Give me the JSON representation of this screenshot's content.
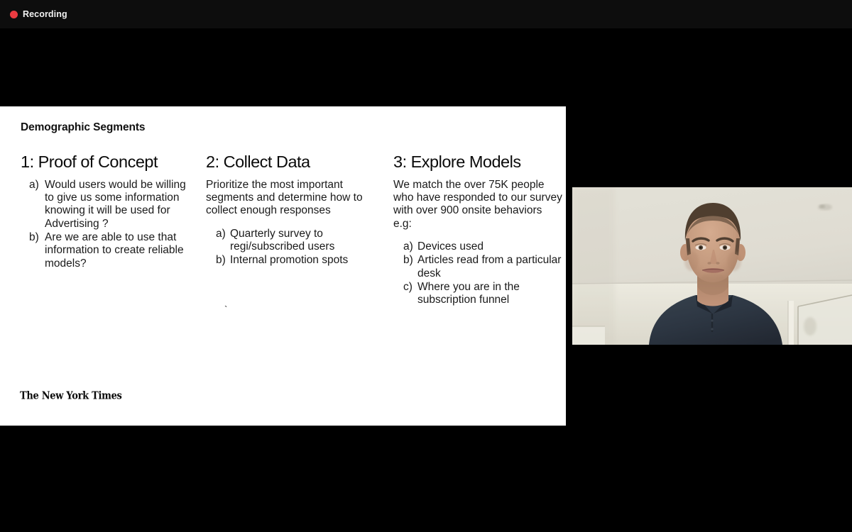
{
  "recording": {
    "label": "Recording",
    "dot_color": "#ea3b41",
    "text_color": "#f2f2f2"
  },
  "slide": {
    "title": "Demographic Segments",
    "background": "#ffffff",
    "footer_logo": "The New York Times",
    "stray_mark": "`",
    "columns": [
      {
        "heading": "1: Proof of Concept",
        "intro": "",
        "items": [
          {
            "marker": "a)",
            "text": "Would users would be willing to give us some information knowing it will be used for Advertising ?"
          },
          {
            "marker": "b)",
            "text": "Are we are able to use that information to create reliable models?"
          }
        ]
      },
      {
        "heading": "2: Collect Data",
        "intro": "Prioritize the most important segments and determine how to collect enough responses",
        "items": [
          {
            "marker": "a)",
            "text": "Quarterly survey to regi/subscribed users"
          },
          {
            "marker": "b)",
            "text": "Internal promotion spots"
          }
        ]
      },
      {
        "heading": "3: Explore Models",
        "intro": "We match the over 75K people who have responded to our survey with over 900 onsite behaviors e.g:",
        "items": [
          {
            "marker": "a)",
            "text": "Devices used"
          },
          {
            "marker": "b)",
            "text": "Articles read from a particular desk"
          },
          {
            "marker": "c)",
            "text": "Where you are in the subscription funnel"
          }
        ]
      }
    ]
  },
  "video": {
    "label": "participant-webcam",
    "description": "Man in dark navy polo shirt seated in front of a light beige wall with a white door frame on the right",
    "wall_color": "#ddd9cf",
    "shirt_color": "#2a3340",
    "skin_color": "#c79a7e",
    "hair_color": "#4c3a2c"
  },
  "stage": {
    "background": "#000000"
  }
}
